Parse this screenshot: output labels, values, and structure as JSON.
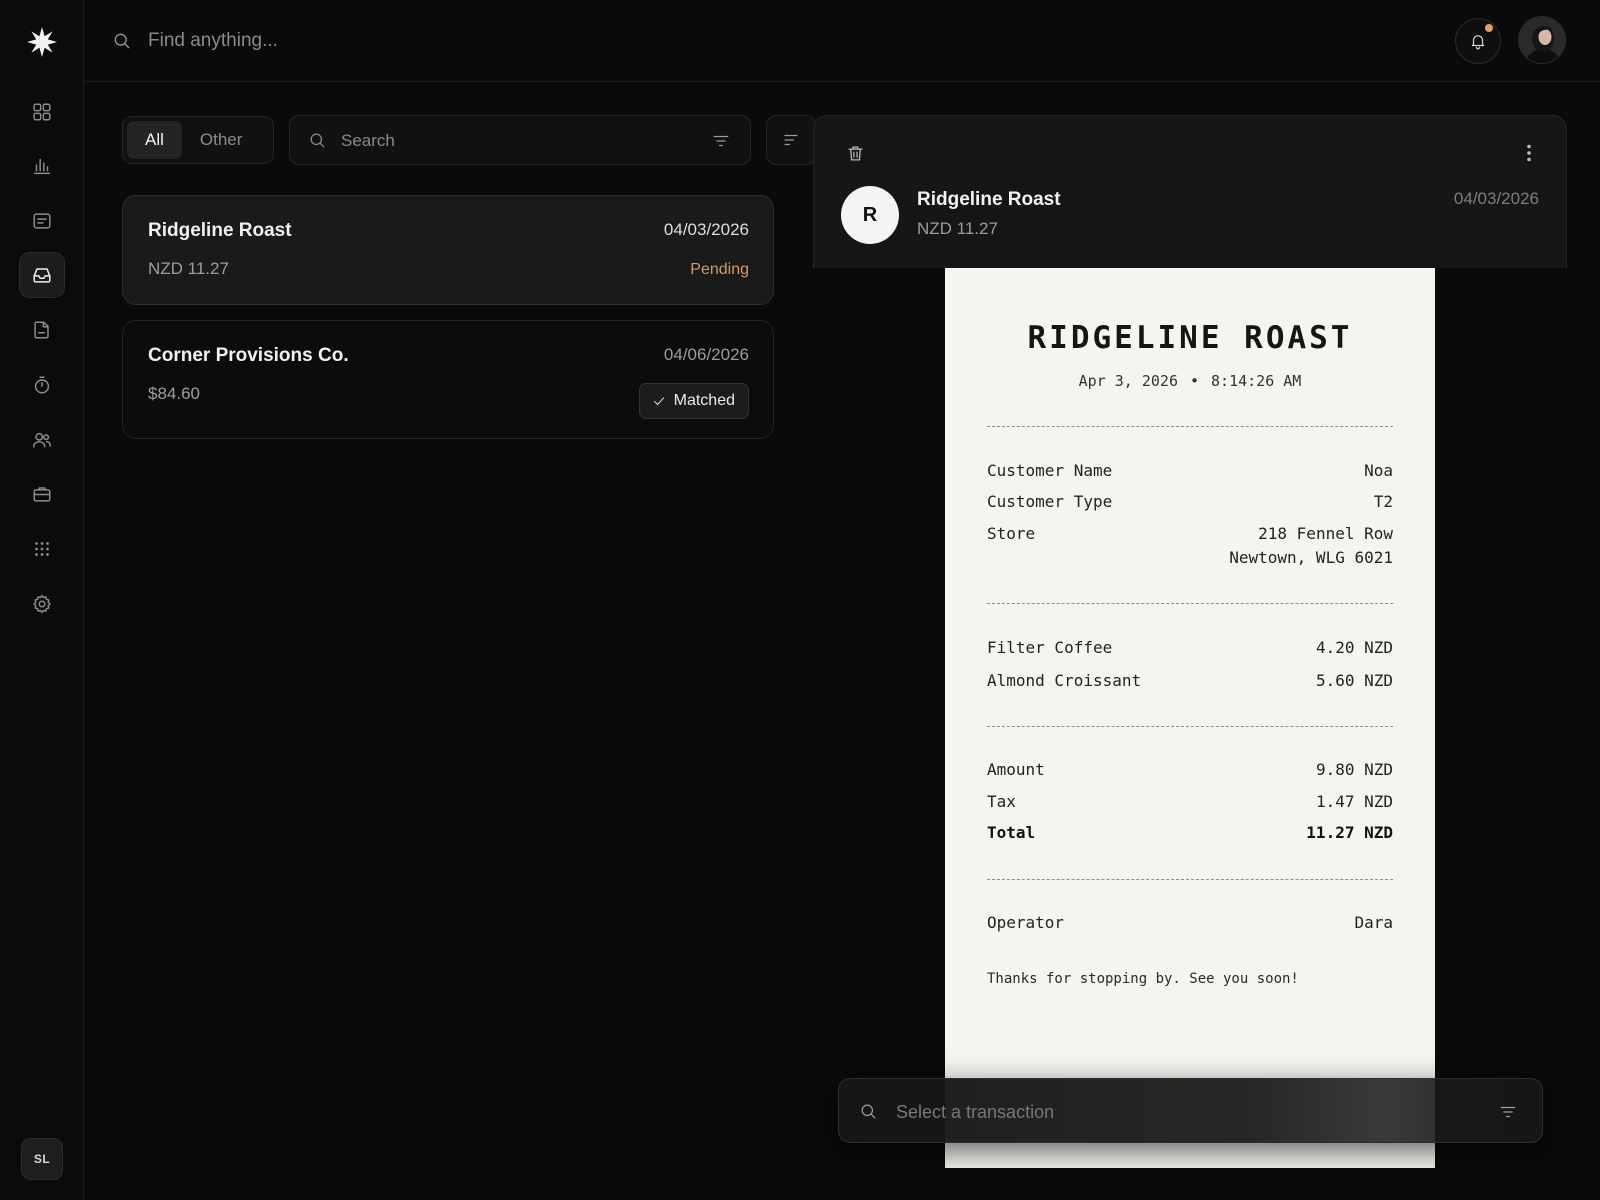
{
  "app": {
    "global_search_placeholder": "Find anything...",
    "user_initials": "SL",
    "notification_dot_color": "#d9a267"
  },
  "sidebar": {
    "items": [
      {
        "name": "dashboard-grid-icon",
        "active": false
      },
      {
        "name": "analytics-bars-icon",
        "active": false
      },
      {
        "name": "documents-icon",
        "active": false
      },
      {
        "name": "inbox-icon",
        "active": true
      },
      {
        "name": "file-icon",
        "active": false
      },
      {
        "name": "timer-icon",
        "active": false
      },
      {
        "name": "users-icon",
        "active": false
      },
      {
        "name": "briefcase-icon",
        "active": false
      },
      {
        "name": "apps-grid-icon",
        "active": false
      },
      {
        "name": "settings-gear-icon",
        "active": false
      }
    ]
  },
  "list": {
    "tabs": [
      "All",
      "Other"
    ],
    "active_tab": "All",
    "search_placeholder": "Search",
    "transactions": [
      {
        "name": "Ridgeline Roast",
        "date": "04/03/2026",
        "amount": "NZD 11.27",
        "status": "Pending",
        "selected": true
      },
      {
        "name": "Corner Provisions Co.",
        "date": "04/06/2026",
        "amount": "$84.60",
        "status": "Matched",
        "selected": false
      }
    ]
  },
  "detail": {
    "avatar_letter": "R",
    "name": "Ridgeline Roast",
    "amount": "NZD 11.27",
    "date": "04/03/2026",
    "bottom_search_placeholder": "Select a transaction"
  },
  "receipt": {
    "title": "RIDGELINE ROAST",
    "date": "Apr 3, 2026",
    "separator": "•",
    "time": "8:14:26 AM",
    "customer_name_label": "Customer Name",
    "customer_name": "Noa",
    "customer_type_label": "Customer Type",
    "customer_type": "T2",
    "store_label": "Store",
    "store_line1": "218 Fennel Row",
    "store_line2": "Newtown, WLG 6021",
    "items": [
      {
        "label": "Filter Coffee",
        "value": "4.20 NZD"
      },
      {
        "label": "Almond Croissant",
        "value": "5.60 NZD"
      }
    ],
    "amount_label": "Amount",
    "amount": "9.80 NZD",
    "tax_label": "Tax",
    "tax": "1.47 NZD",
    "total_label": "Total",
    "total": "11.27 NZD",
    "operator_label": "Operator",
    "operator": "Dara",
    "footer": "Thanks for stopping by. See you soon!"
  }
}
